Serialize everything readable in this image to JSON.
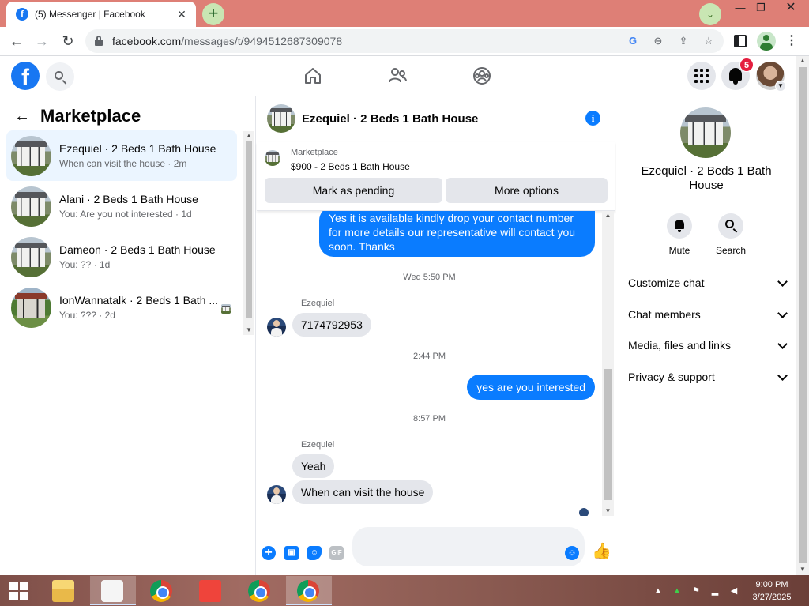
{
  "browser": {
    "tab_title": "(5) Messenger | Facebook",
    "favicon_letter": "f",
    "url_host": "facebook.com",
    "url_path": "/messages/t/9494512687309078",
    "close_tab_glyph": "✕",
    "new_tab_glyph": "+",
    "icons": [
      "facebook-favicon",
      "back-arrow-icon",
      "forward-arrow-icon",
      "reload-icon",
      "lock-icon",
      "google-icon",
      "zoom-icon",
      "share-icon",
      "star-icon",
      "side-panel-icon",
      "profile-icon",
      "kebab-menu-icon"
    ]
  },
  "fb": {
    "logo_letter": "f",
    "notifications_count": "5",
    "nav_icons": [
      "home-icon",
      "friends-icon",
      "groups-icon"
    ]
  },
  "left": {
    "title": "Marketplace",
    "conversations": [
      {
        "name": "Ezequiel · 2 Beds 1 Bath House",
        "snippet": "When can visit the house · 2m",
        "active": true
      },
      {
        "name": "Alani · 2 Beds 1 Bath House",
        "snippet": "You: Are you not interested · 1d",
        "active": false
      },
      {
        "name": "Dameon · 2 Beds 1 Bath House",
        "snippet": "You: ?? · 1d",
        "active": false
      },
      {
        "name": "IonWannatalk · 2 Beds 1 Bath ...",
        "snippet": "You: ??? · 2d",
        "active": false
      }
    ]
  },
  "chat": {
    "title": "Ezequiel · 2 Beds 1 Bath House",
    "listing": {
      "label": "Marketplace",
      "price_title": "$900 - 2 Beds 1 Bath House",
      "pending_button": "Mark as pending",
      "options_button": "More options"
    },
    "messages": {
      "out_long": "Yes it is available kindly drop your contact number for more details our representative will contact you soon. Thanks",
      "time1": "Wed 5:50 PM",
      "sender1": "Ezequiel",
      "in_phone": "7174792953",
      "time2": "2:44 PM",
      "out_short": "yes are you interested",
      "time3": "8:57 PM",
      "sender2": "Ezequiel",
      "in_yeah": "Yeah",
      "in_visit": "When can visit the house"
    },
    "composer": {
      "placeholder": "",
      "gif_label": "GIF"
    }
  },
  "right": {
    "name": "Ezequiel · 2 Beds 1 Bath House",
    "mute_label": "Mute",
    "search_label": "Search",
    "sections": [
      "Customize chat",
      "Chat members",
      "Media, files and links",
      "Privacy & support"
    ]
  },
  "taskbar": {
    "time": "9:00 PM",
    "date": "3/27/2025"
  },
  "colors": {
    "messenger_blue": "#0a7cff",
    "facebook_blue": "#1877f2",
    "tabstrip": "#de7f76",
    "badge_red": "#e41e3f"
  }
}
